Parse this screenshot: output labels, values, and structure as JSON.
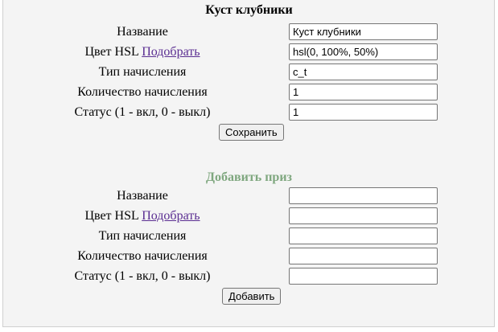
{
  "edit_form": {
    "title": "Куст клубники",
    "name_label": "Название",
    "color_label": "Цвет HSL",
    "color_pick_link": "Подобрать",
    "type_label": "Тип начисления",
    "amount_label": "Количество начисления",
    "status_label": "Статус (1 - вкл, 0 - выкл)",
    "name_value": "Куст клубники",
    "color_value": "hsl(0, 100%, 50%)",
    "type_value": "c_t",
    "amount_value": "1",
    "status_value": "1",
    "save_button": "Сохранить"
  },
  "add_form": {
    "title": "Добавить приз",
    "title_color": "#7fa77f",
    "name_label": "Название",
    "color_label": "Цвет HSL",
    "color_pick_link": "Подобрать",
    "type_label": "Тип начисления",
    "amount_label": "Количество начисления",
    "status_label": "Статус (1 - вкл, 0 - выкл)",
    "name_value": "",
    "color_value": "",
    "type_value": "",
    "amount_value": "",
    "status_value": "",
    "add_button": "Добавить"
  }
}
